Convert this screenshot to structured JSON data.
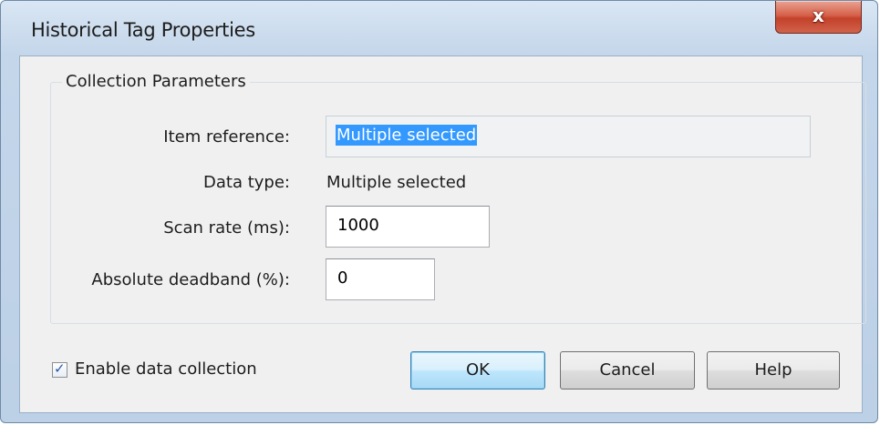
{
  "window": {
    "title": "Historical Tag Properties",
    "close_label": "x"
  },
  "group": {
    "label": "Collection Parameters"
  },
  "fields": {
    "item_reference": {
      "label": "Item reference:",
      "value": "Multiple selected"
    },
    "data_type": {
      "label": "Data type:",
      "value": "Multiple selected"
    },
    "scan_rate": {
      "label": "Scan rate (ms):",
      "value": "1000"
    },
    "deadband": {
      "label": "Absolute deadband (%):",
      "value": "0"
    }
  },
  "enable_collection": {
    "label": "Enable data collection",
    "checked": true
  },
  "buttons": {
    "ok": "OK",
    "cancel": "Cancel",
    "help": "Help"
  },
  "colors": {
    "selection": "#3399ff",
    "close_button": "#c4412a",
    "default_button_border": "#3c7fb1"
  },
  "icons": {
    "close": "close-icon",
    "check": "checkmark-icon"
  }
}
